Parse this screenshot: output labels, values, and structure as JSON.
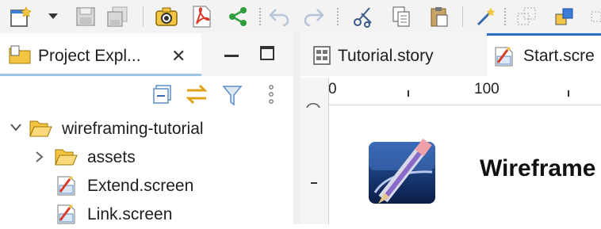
{
  "toolbar": {
    "icons": [
      "new-wizard-icon",
      "dropdown-arrow-icon",
      "save-icon",
      "save-all-icon",
      "screenshot-camera-icon",
      "export-pdf-icon",
      "share-icon",
      "undo-icon",
      "redo-icon",
      "cut-icon",
      "copy-icon",
      "paste-icon",
      "magic-wand-icon",
      "resize-icon",
      "arrange-icon"
    ]
  },
  "project_explorer": {
    "tab_label": "Project Expl...",
    "close_glyph": "✕",
    "tree": [
      {
        "label": "wireframing-tutorial",
        "type": "project",
        "expanded": true
      },
      {
        "label": "assets",
        "type": "folder",
        "expanded": false
      },
      {
        "label": "Extend.screen",
        "type": "screen"
      },
      {
        "label": "Link.screen",
        "type": "screen"
      }
    ]
  },
  "editor": {
    "tabs": [
      {
        "label": "Tutorial.story",
        "active": false
      },
      {
        "label": "Start.scre",
        "active": true
      }
    ],
    "ruler_labels": [
      "0",
      "100"
    ],
    "app_title": "Wireframe"
  },
  "colors": {
    "accent_blue": "#2e6fbf",
    "folder_yellow": "#f4c542",
    "pdf_red": "#d83b2b",
    "share_green": "#2e9e3e"
  }
}
